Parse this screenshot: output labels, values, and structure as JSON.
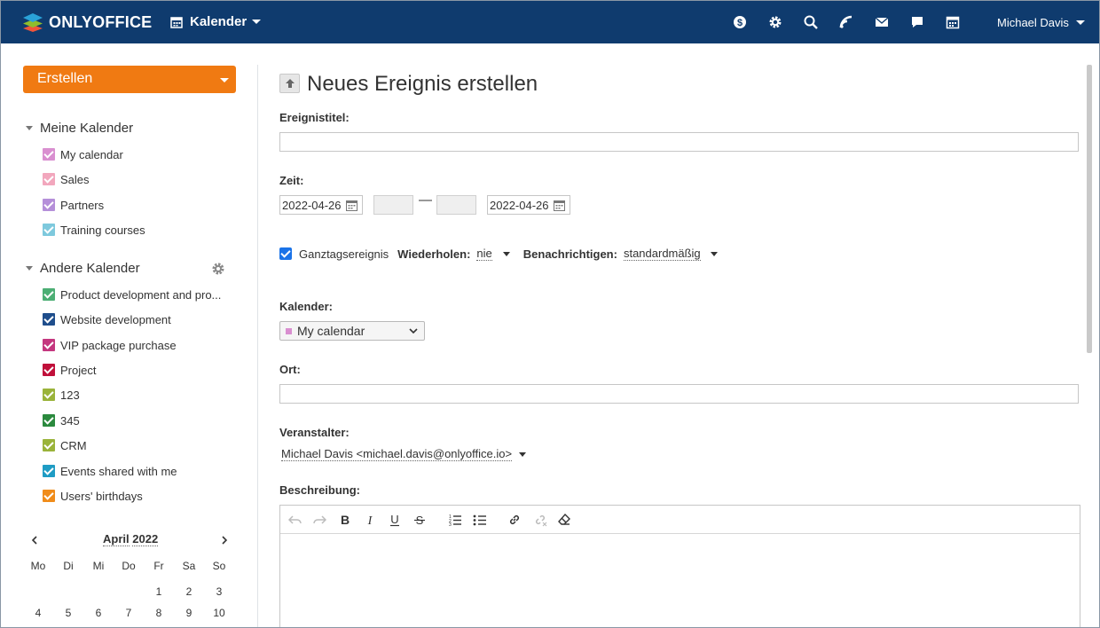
{
  "header": {
    "brand": "ONLYOFFICE",
    "module": "Kalender",
    "user_name": "Michael Davis",
    "icons": [
      "payments-icon",
      "settings-icon",
      "search-icon",
      "feed-icon",
      "mail-icon",
      "chat-icon",
      "calendar-icon"
    ]
  },
  "sidebar": {
    "create_label": "Erstellen",
    "my_calendars_title": "Meine Kalender",
    "my_calendars": [
      {
        "label": "My calendar",
        "color": "#d98fd0"
      },
      {
        "label": "Sales",
        "color": "#f2a7bd"
      },
      {
        "label": "Partners",
        "color": "#b58fd9"
      },
      {
        "label": "Training courses",
        "color": "#7ec9dd"
      }
    ],
    "other_calendars_title": "Andere Kalender",
    "other_calendars": [
      {
        "label": "Product development and pro...",
        "color": "#4cae74"
      },
      {
        "label": "Website development",
        "color": "#1f4e8c"
      },
      {
        "label": "VIP package purchase",
        "color": "#c4377f"
      },
      {
        "label": "Project",
        "color": "#c0103a"
      },
      {
        "label": "123",
        "color": "#9ab33a"
      },
      {
        "label": "345",
        "color": "#2b8a3e"
      },
      {
        "label": "CRM",
        "color": "#9ab33a"
      },
      {
        "label": "Events shared with me",
        "color": "#1f9cc4"
      },
      {
        "label": "Users' birthdays",
        "color": "#f08c1a"
      }
    ],
    "mini_calendar": {
      "month": "April",
      "year": "2022",
      "weekdays": [
        "Mo",
        "Di",
        "Mi",
        "Do",
        "Fr",
        "Sa",
        "So"
      ],
      "week1": [
        "",
        "",
        "",
        "",
        "1",
        "2",
        "3"
      ],
      "week2": [
        "4",
        "5",
        "6",
        "7",
        "8",
        "9",
        "10"
      ]
    }
  },
  "form": {
    "title": "Neues Ereignis erstellen",
    "event_title_label": "Ereignistitel:",
    "event_title_value": "",
    "time_label": "Zeit:",
    "start_date": "2022-04-26",
    "end_date": "2022-04-26",
    "dash": "—",
    "allday_label": "Ganztagsereignis",
    "allday_checked": true,
    "repeat_label": "Wiederholen:",
    "repeat_value": "nie",
    "notify_label": "Benachrichtigen:",
    "notify_value": "standardmäßig",
    "calendar_label": "Kalender:",
    "calendar_value": "My calendar",
    "calendar_color": "#d98fd0",
    "location_label": "Ort:",
    "location_value": "",
    "organizer_label": "Veranstalter:",
    "organizer_value": "Michael Davis <michael.davis@onlyoffice.io>",
    "description_label": "Beschreibung:"
  },
  "colors": {
    "header_bg": "#0f3b6e",
    "accent": "#f07a12",
    "checkbox_blue": "#1a73e8"
  }
}
